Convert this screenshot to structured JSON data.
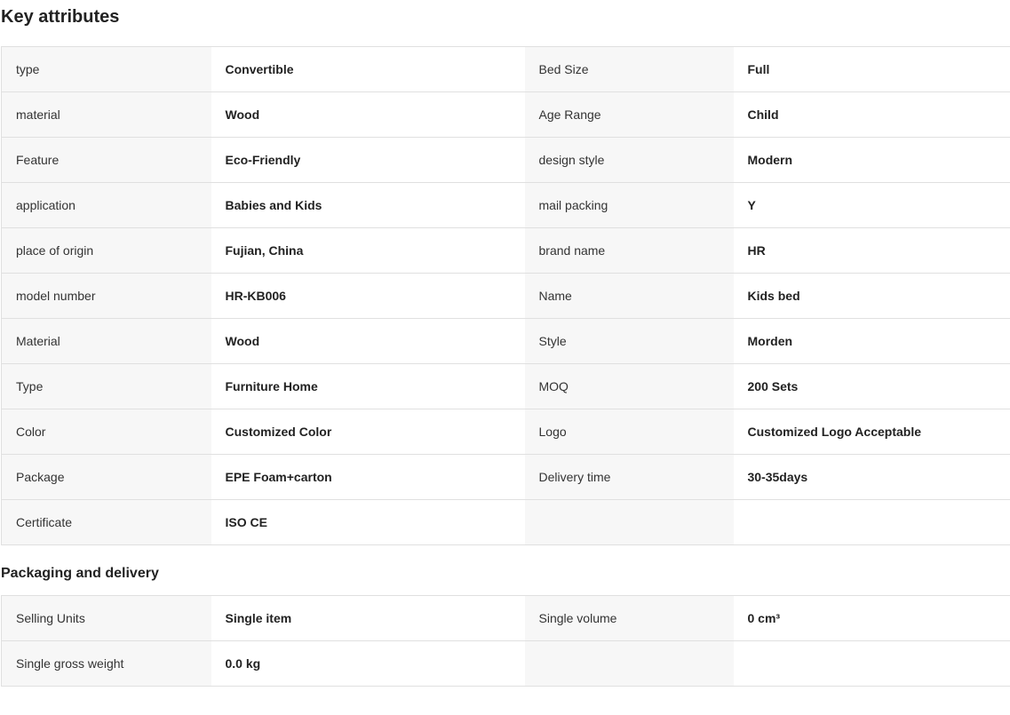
{
  "key_attributes": {
    "title": "Key attributes",
    "rows": [
      {
        "l1": "type",
        "v1": "Convertible",
        "l2": "Bed Size",
        "v2": "Full"
      },
      {
        "l1": "material",
        "v1": "Wood",
        "l2": "Age Range",
        "v2": "Child"
      },
      {
        "l1": "Feature",
        "v1": "Eco-Friendly",
        "l2": "design style",
        "v2": "Modern"
      },
      {
        "l1": "application",
        "v1": "Babies and Kids",
        "l2": "mail packing",
        "v2": "Y"
      },
      {
        "l1": "place of origin",
        "v1": "Fujian, China",
        "l2": "brand name",
        "v2": "HR"
      },
      {
        "l1": "model number",
        "v1": "HR-KB006",
        "l2": "Name",
        "v2": "Kids bed"
      },
      {
        "l1": "Material",
        "v1": "Wood",
        "l2": "Style",
        "v2": "Morden"
      },
      {
        "l1": "Type",
        "v1": "Furniture Home",
        "l2": "MOQ",
        "v2": "200 Sets"
      },
      {
        "l1": "Color",
        "v1": "Customized Color",
        "l2": "Logo",
        "v2": "Customized Logo Acceptable"
      },
      {
        "l1": "Package",
        "v1": "EPE Foam+carton",
        "l2": "Delivery time",
        "v2": "30-35days"
      },
      {
        "l1": "Certificate",
        "v1": "ISO CE",
        "l2": "",
        "v2": ""
      }
    ]
  },
  "packaging_delivery": {
    "title": "Packaging and delivery",
    "rows": [
      {
        "l1": "Selling Units",
        "v1": "Single item",
        "l2": "Single volume",
        "v2": "0 cm³"
      },
      {
        "l1": "Single gross weight",
        "v1": "0.0 kg",
        "l2": "",
        "v2": ""
      }
    ]
  }
}
